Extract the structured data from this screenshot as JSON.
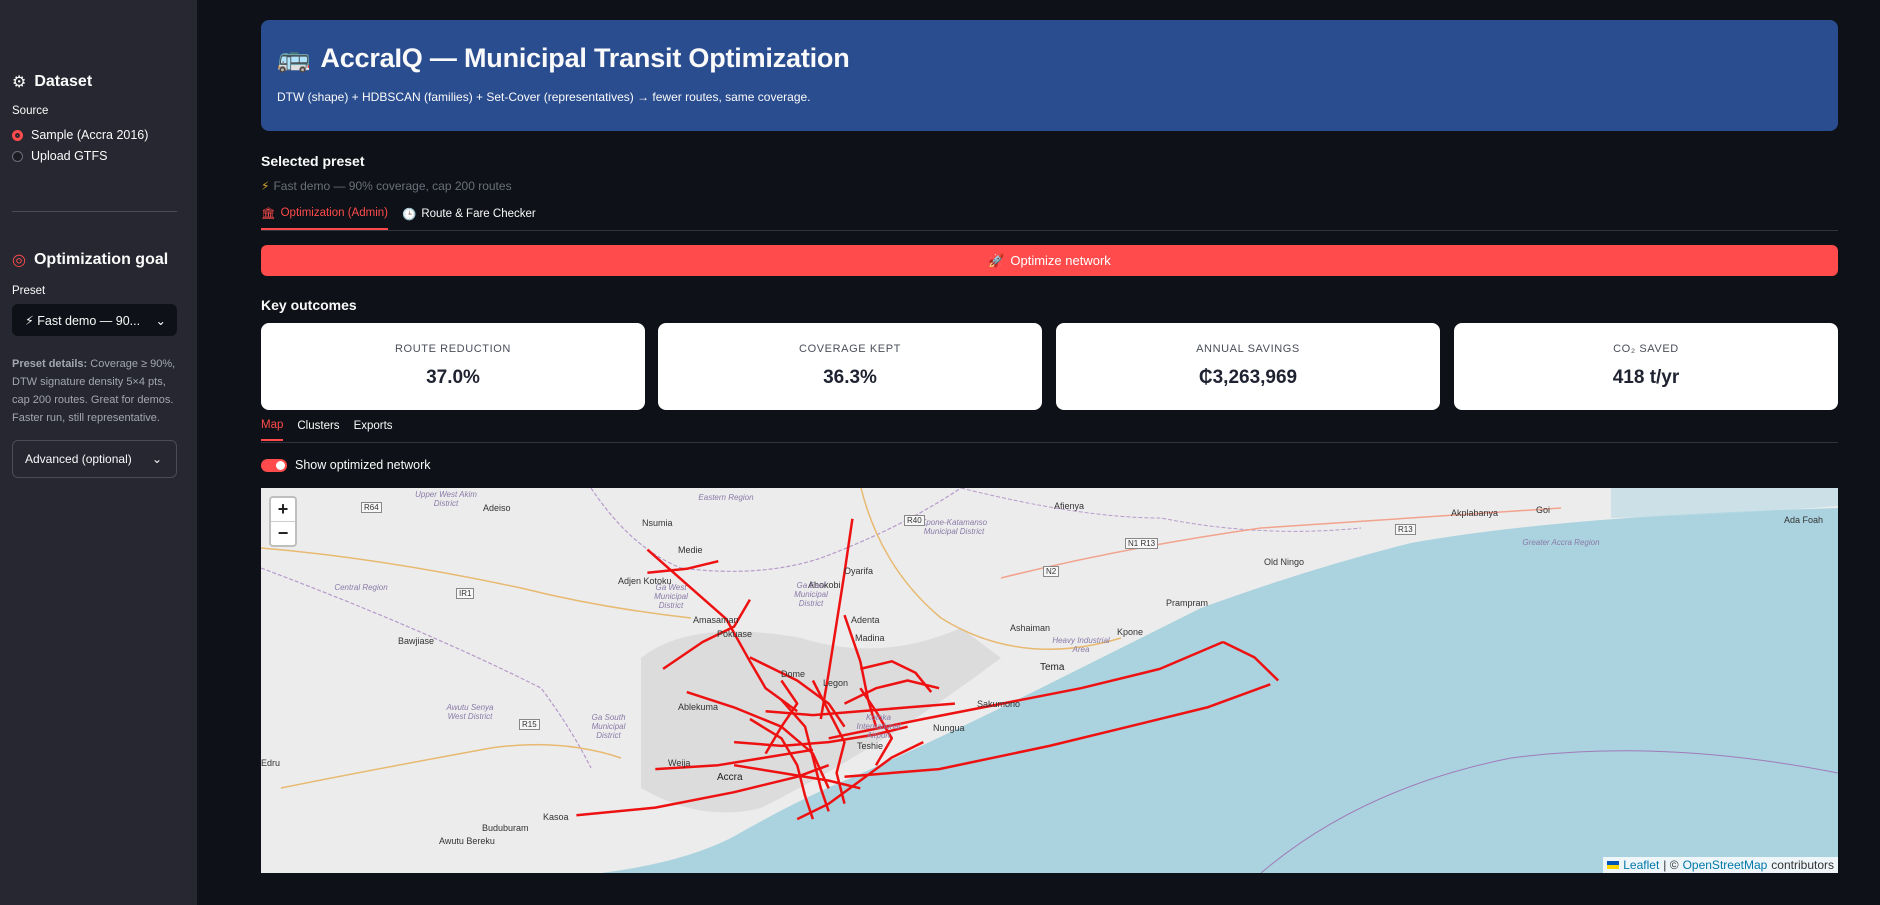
{
  "sidebar": {
    "dataset_heading": "Dataset",
    "source_label": "Source",
    "source_options": [
      "Sample (Accra 2016)",
      "Upload GTFS"
    ],
    "goal_heading": "Optimization goal",
    "preset_label": "Preset",
    "preset_selected": "⚡ Fast demo — 90...",
    "preset_details_bold": "Preset details:",
    "preset_details_text": " Coverage ≥ 90%, DTW signature density 5×4 pts, cap 200 routes. Great for demos. Faster run, still representative.",
    "advanced_label": "Advanced (optional)"
  },
  "banner": {
    "title": "AccraIQ — Municipal Transit Optimization",
    "subtitle": "DTW (shape) + HDBSCAN (families) + Set-Cover (representatives) → fewer routes, same coverage."
  },
  "selected_preset": {
    "heading": "Selected preset",
    "caption": "Fast demo — 90% coverage, cap 200 routes"
  },
  "top_tabs": [
    "Optimization (Admin)",
    "Route & Fare Checker"
  ],
  "optimize_button": "Optimize network",
  "outcomes": {
    "heading": "Key outcomes",
    "cards": [
      {
        "label": "ROUTE REDUCTION",
        "value": "37.0%"
      },
      {
        "label": "COVERAGE KEPT",
        "value": "36.3%"
      },
      {
        "label": "ANNUAL SAVINGS",
        "value": "₵3,263,969"
      },
      {
        "label": "CO₂ SAVED",
        "value": "418 t/yr"
      }
    ]
  },
  "result_tabs": [
    "Map",
    "Clusters",
    "Exports"
  ],
  "toggle_label": "Show optimized network",
  "map": {
    "zoom_in": "+",
    "zoom_out": "−",
    "attribution": {
      "leaflet": "Leaflet",
      "sep": "| ©",
      "osm": "OpenStreetMap",
      "contributors": "contributors"
    },
    "places": [
      "Adeiso",
      "Nsumia",
      "Medie",
      "Adjen Kotoku",
      "Amasaman",
      "Pokuase",
      "Oyarifa",
      "Abokobi",
      "Adenta",
      "Madina",
      "Dome",
      "Legon",
      "Ablekuma",
      "Weija",
      "Kasoa",
      "Buduburam",
      "Awutu Bereku",
      "Bawjiase",
      "Afienya",
      "Old Ningo",
      "Prampram",
      "Ashaiman",
      "Kpone",
      "Tema",
      "Sakumono",
      "Nungua",
      "Teshie",
      "Accra",
      "Akplabanya",
      "Ada Foah",
      "Goi",
      "Edru"
    ],
    "districts": [
      "Upper West Akim District",
      "Ga West Municipal District",
      "Ga East Municipal District",
      "Kpone-Katamanso Municipal District",
      "Awutu Senya West District",
      "Ga South Municipal District",
      "Heavy Industrial Area",
      "Eastern Region",
      "Central Region",
      "Greater Accra Region",
      "Kotoka International Airport"
    ],
    "roads": [
      "R64",
      "R40",
      "N2",
      "N1 R13",
      "R13",
      "R15",
      "IR1"
    ],
    "routes": [
      {
        "name": "north-west",
        "pts": [
          [
            0.245,
            0.16
          ],
          [
            0.27,
            0.25
          ],
          [
            0.295,
            0.34
          ],
          [
            0.31,
            0.45
          ],
          [
            0.32,
            0.52
          ],
          [
            0.34,
            0.58
          ]
        ]
      },
      {
        "name": "adjen",
        "pts": [
          [
            0.245,
            0.22
          ],
          [
            0.27,
            0.21
          ],
          [
            0.29,
            0.19
          ]
        ]
      },
      {
        "name": "amasaman",
        "pts": [
          [
            0.255,
            0.47
          ],
          [
            0.28,
            0.4
          ],
          [
            0.3,
            0.36
          ],
          [
            0.31,
            0.29
          ]
        ]
      },
      {
        "name": "pokuase",
        "pts": [
          [
            0.31,
            0.44
          ],
          [
            0.34,
            0.5
          ],
          [
            0.36,
            0.56
          ],
          [
            0.37,
            0.62
          ]
        ]
      },
      {
        "name": "dome-north",
        "pts": [
          [
            0.375,
            0.08
          ],
          [
            0.37,
            0.22
          ],
          [
            0.365,
            0.35
          ],
          [
            0.36,
            0.48
          ],
          [
            0.355,
            0.6
          ]
        ]
      },
      {
        "name": "madina",
        "pts": [
          [
            0.37,
            0.33
          ],
          [
            0.38,
            0.45
          ],
          [
            0.385,
            0.55
          ],
          [
            0.39,
            0.62
          ]
        ]
      },
      {
        "name": "adenta",
        "pts": [
          [
            0.38,
            0.47
          ],
          [
            0.4,
            0.45
          ],
          [
            0.415,
            0.48
          ],
          [
            0.425,
            0.53
          ]
        ]
      },
      {
        "name": "east-corridor",
        "pts": [
          [
            0.36,
            0.65
          ],
          [
            0.42,
            0.6
          ],
          [
            0.47,
            0.56
          ],
          [
            0.52,
            0.52
          ],
          [
            0.57,
            0.47
          ],
          [
            0.61,
            0.4
          ]
        ]
      },
      {
        "name": "tema-coast",
        "pts": [
          [
            0.37,
            0.75
          ],
          [
            0.43,
            0.73
          ],
          [
            0.5,
            0.67
          ],
          [
            0.55,
            0.62
          ],
          [
            0.6,
            0.57
          ],
          [
            0.64,
            0.51
          ]
        ]
      },
      {
        "name": "tema-north",
        "pts": [
          [
            0.61,
            0.4
          ],
          [
            0.63,
            0.44
          ],
          [
            0.645,
            0.5
          ]
        ]
      },
      {
        "name": "kasoa",
        "pts": [
          [
            0.2,
            0.85
          ],
          [
            0.25,
            0.83
          ],
          [
            0.3,
            0.79
          ],
          [
            0.34,
            0.75
          ],
          [
            0.36,
            0.72
          ]
        ]
      },
      {
        "name": "weija",
        "pts": [
          [
            0.25,
            0.73
          ],
          [
            0.29,
            0.72
          ],
          [
            0.32,
            0.7
          ],
          [
            0.35,
            0.68
          ]
        ]
      },
      {
        "name": "ablekuma",
        "pts": [
          [
            0.27,
            0.53
          ],
          [
            0.3,
            0.57
          ],
          [
            0.33,
            0.62
          ],
          [
            0.35,
            0.69
          ],
          [
            0.36,
            0.78
          ]
        ]
      },
      {
        "name": "core1",
        "pts": [
          [
            0.31,
            0.6
          ],
          [
            0.33,
            0.65
          ],
          [
            0.34,
            0.72
          ],
          [
            0.345,
            0.8
          ],
          [
            0.35,
            0.86
          ]
        ]
      },
      {
        "name": "core2",
        "pts": [
          [
            0.33,
            0.55
          ],
          [
            0.345,
            0.62
          ],
          [
            0.35,
            0.7
          ],
          [
            0.355,
            0.78
          ],
          [
            0.36,
            0.84
          ]
        ]
      },
      {
        "name": "core3",
        "pts": [
          [
            0.35,
            0.5
          ],
          [
            0.36,
            0.58
          ],
          [
            0.37,
            0.66
          ],
          [
            0.365,
            0.74
          ],
          [
            0.37,
            0.82
          ]
        ]
      },
      {
        "name": "core4",
        "pts": [
          [
            0.3,
            0.66
          ],
          [
            0.33,
            0.67
          ],
          [
            0.36,
            0.66
          ],
          [
            0.39,
            0.64
          ],
          [
            0.41,
            0.62
          ]
        ]
      },
      {
        "name": "core5",
        "pts": [
          [
            0.32,
            0.58
          ],
          [
            0.35,
            0.59
          ],
          [
            0.38,
            0.58
          ],
          [
            0.41,
            0.57
          ],
          [
            0.44,
            0.56
          ]
        ]
      },
      {
        "name": "core6",
        "pts": [
          [
            0.3,
            0.72
          ],
          [
            0.33,
            0.74
          ],
          [
            0.36,
            0.76
          ],
          [
            0.38,
            0.78
          ]
        ]
      },
      {
        "name": "core7",
        "pts": [
          [
            0.34,
            0.86
          ],
          [
            0.36,
            0.82
          ],
          [
            0.38,
            0.76
          ],
          [
            0.4,
            0.7
          ],
          [
            0.42,
            0.66
          ]
        ]
      },
      {
        "name": "core8",
        "pts": [
          [
            0.33,
            0.5
          ],
          [
            0.34,
            0.56
          ],
          [
            0.33,
            0.62
          ],
          [
            0.32,
            0.69
          ]
        ]
      },
      {
        "name": "core9",
        "pts": [
          [
            0.38,
            0.52
          ],
          [
            0.39,
            0.58
          ],
          [
            0.4,
            0.65
          ],
          [
            0.39,
            0.72
          ]
        ]
      },
      {
        "name": "legon",
        "pts": [
          [
            0.37,
            0.56
          ],
          [
            0.39,
            0.52
          ],
          [
            0.41,
            0.5
          ],
          [
            0.43,
            0.52
          ]
        ]
      }
    ]
  }
}
